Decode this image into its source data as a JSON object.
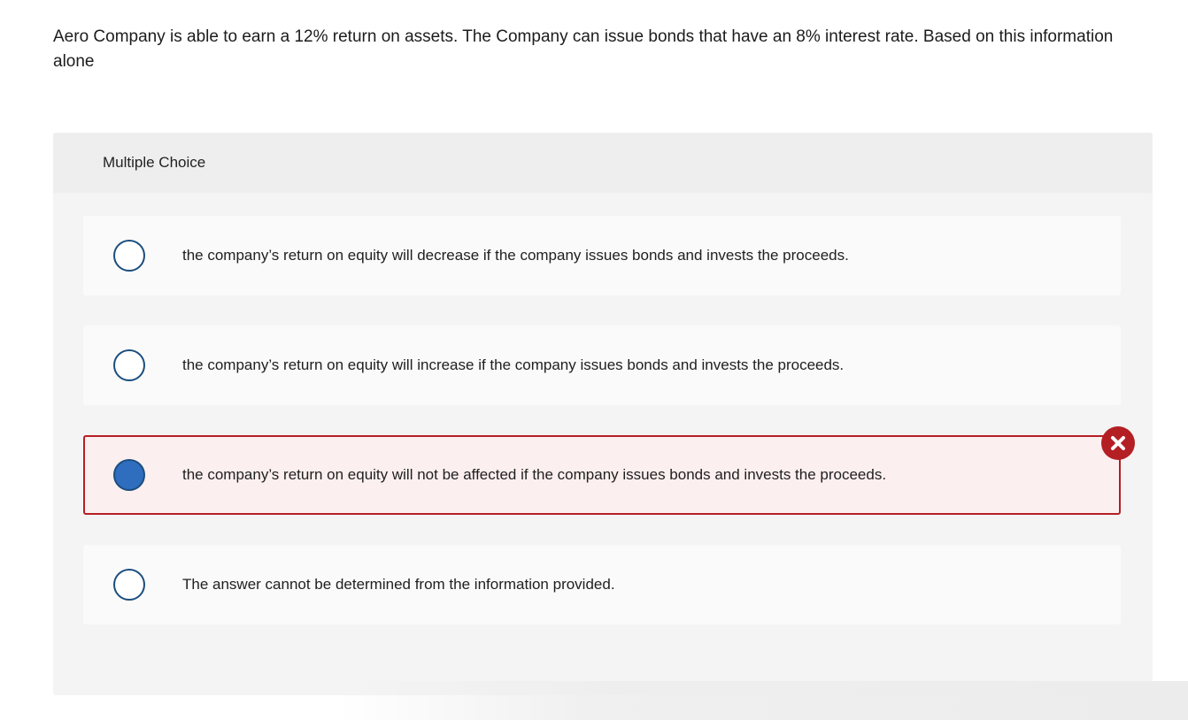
{
  "question": {
    "text": "Aero Company is able to earn a 12% return on assets. The Company can issue bonds that have an 8% interest rate. Based on this information alone"
  },
  "panel": {
    "header": "Multiple Choice"
  },
  "options": [
    {
      "label": "the company’s return on equity will decrease if the company issues bonds and invests the proceeds.",
      "selected": false,
      "status": "none"
    },
    {
      "label": "the company’s return on equity will increase if the company issues bonds and invests the proceeds.",
      "selected": false,
      "status": "none"
    },
    {
      "label": "the company’s return on equity will not be affected if the company issues bonds and invests the proceeds.",
      "selected": true,
      "status": "incorrect"
    },
    {
      "label": "The answer cannot be determined from the information provided.",
      "selected": false,
      "status": "none"
    }
  ],
  "icons": {
    "incorrect": "x-circle-icon"
  },
  "colors": {
    "radio_border": "#1b4e7e",
    "radio_selected": "#2f6dbf",
    "incorrect": "#b41f24",
    "incorrect_bg": "#fcefef"
  }
}
